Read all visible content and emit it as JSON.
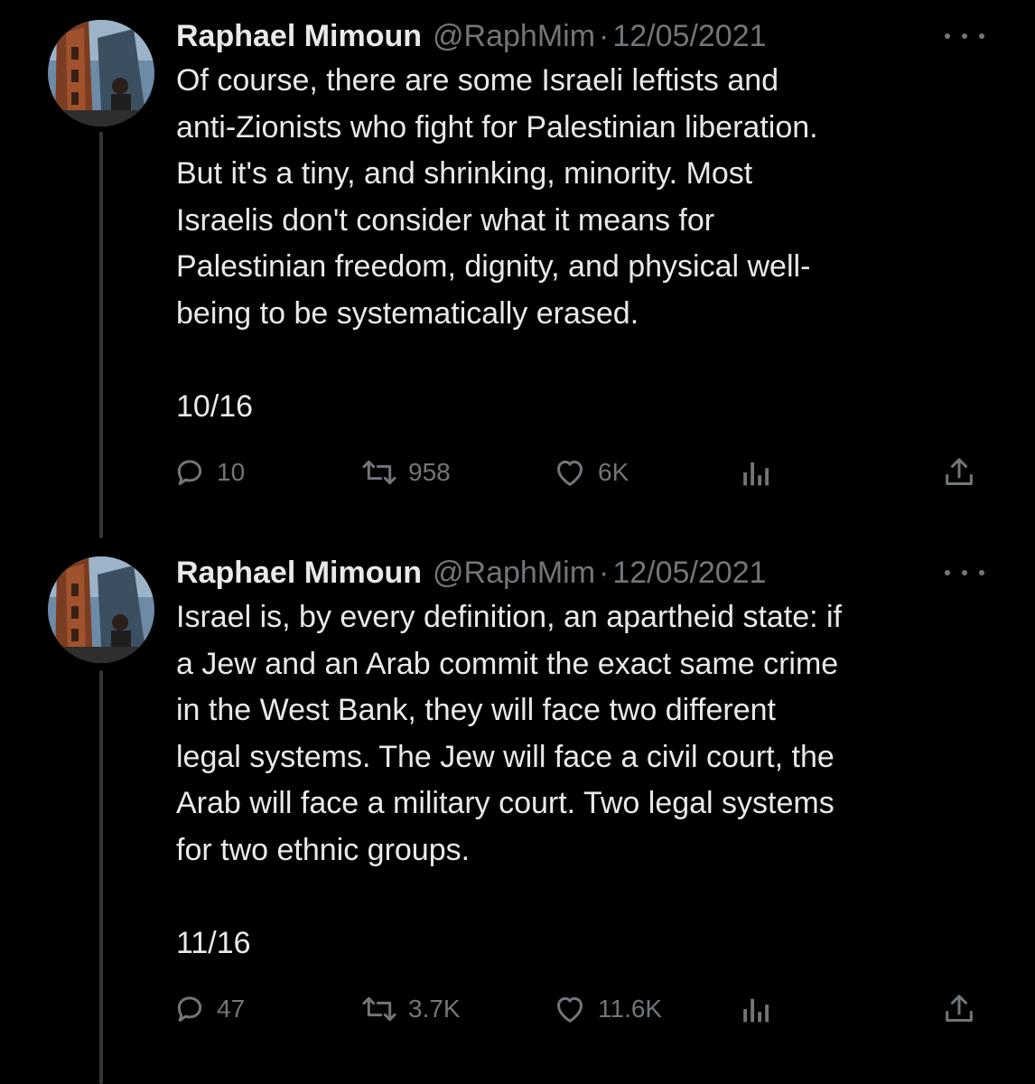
{
  "tweets": [
    {
      "display_name": "Raphael Mimoun",
      "handle": "@RaphMim",
      "separator": "·",
      "date": "12/05/2021",
      "body_lines": [
        "Of course, there are some Israeli leftists and",
        "anti-Zionists who fight for Palestinian liberation.",
        "But it's a tiny, and shrinking, minority. Most",
        "Israelis don't consider what it means for",
        "Palestinian freedom, dignity, and physical well-",
        "being to be systematically erased."
      ],
      "thread_counter": "10/16",
      "actions": {
        "replies": "10",
        "retweets": "958",
        "likes": "6K"
      },
      "icons": [
        "reply-icon",
        "retweet-icon",
        "like-icon",
        "views-icon",
        "share-icon"
      ]
    },
    {
      "display_name": "Raphael Mimoun",
      "handle": "@RaphMim",
      "separator": "·",
      "date": "12/05/2021",
      "body_lines": [
        "Israel is, by every definition, an apartheid state: if",
        "a Jew and an Arab commit the exact same crime",
        "in the West Bank, they will face two different",
        "legal systems. The Jew will face a civil court, the",
        "Arab will face a military court. Two legal systems",
        "for two ethnic groups."
      ],
      "thread_counter": "11/16",
      "actions": {
        "replies": "47",
        "retweets": "3.7K",
        "likes": "11.6K"
      },
      "icons": [
        "reply-icon",
        "retweet-icon",
        "like-icon",
        "views-icon",
        "share-icon"
      ]
    }
  ],
  "colors": {
    "background": "#000000",
    "text": "#e7e9ea",
    "secondary_text": "#71767b",
    "thread_line": "#333639"
  }
}
